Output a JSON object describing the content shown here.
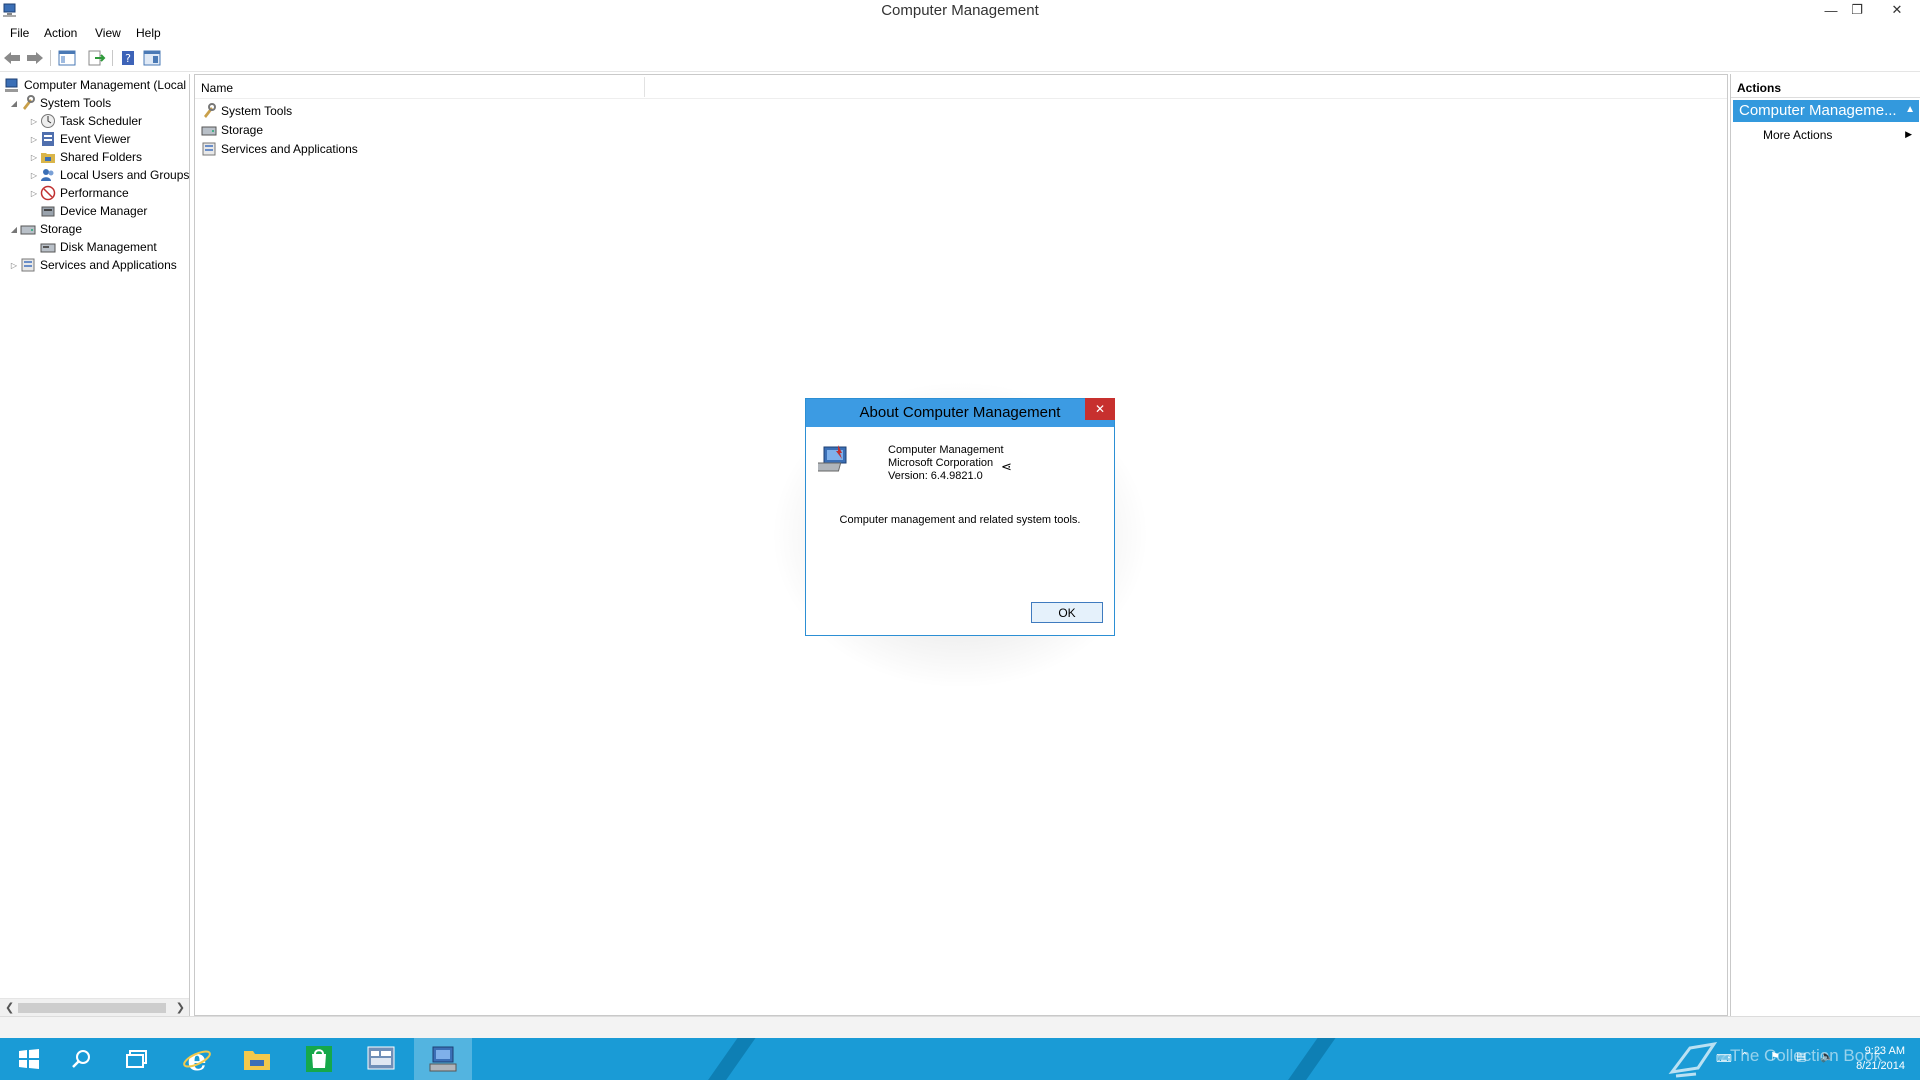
{
  "window": {
    "title": "Computer Management"
  },
  "menu": {
    "items": [
      "File",
      "Action",
      "View",
      "Help"
    ]
  },
  "tree": {
    "items": [
      {
        "label": "Computer Management (Local",
        "icon": "computer-management-icon"
      },
      {
        "label": "System Tools",
        "icon": "system-tools-icon"
      },
      {
        "label": "Task Scheduler",
        "icon": "task-scheduler-icon"
      },
      {
        "label": "Event Viewer",
        "icon": "event-viewer-icon"
      },
      {
        "label": "Shared Folders",
        "icon": "shared-folders-icon"
      },
      {
        "label": "Local Users and Groups",
        "icon": "users-icon"
      },
      {
        "label": "Performance",
        "icon": "performance-icon"
      },
      {
        "label": "Device Manager",
        "icon": "device-manager-icon"
      },
      {
        "label": "Storage",
        "icon": "storage-icon"
      },
      {
        "label": "Disk Management",
        "icon": "disk-management-icon"
      },
      {
        "label": "Services and Applications",
        "icon": "services-icon"
      }
    ]
  },
  "center": {
    "column_header": "Name",
    "items": [
      "System Tools",
      "Storage",
      "Services and Applications"
    ]
  },
  "actions": {
    "header": "Actions",
    "group": "Computer Manageme...",
    "item": "More Actions"
  },
  "dialog": {
    "title": "About Computer Management",
    "product": "Computer Management",
    "company": "Microsoft Corporation",
    "version": "Version: 6.4.9821.0",
    "description": "Computer management and related system tools.",
    "ok_label": "OK"
  },
  "taskbar": {
    "watermark": "The Collection Book",
    "time": "9:23 AM",
    "date": "8/21/2014"
  },
  "colors": {
    "accent": "#3399dd",
    "taskbar": "#1a9bd6",
    "close": "#c7302e"
  }
}
